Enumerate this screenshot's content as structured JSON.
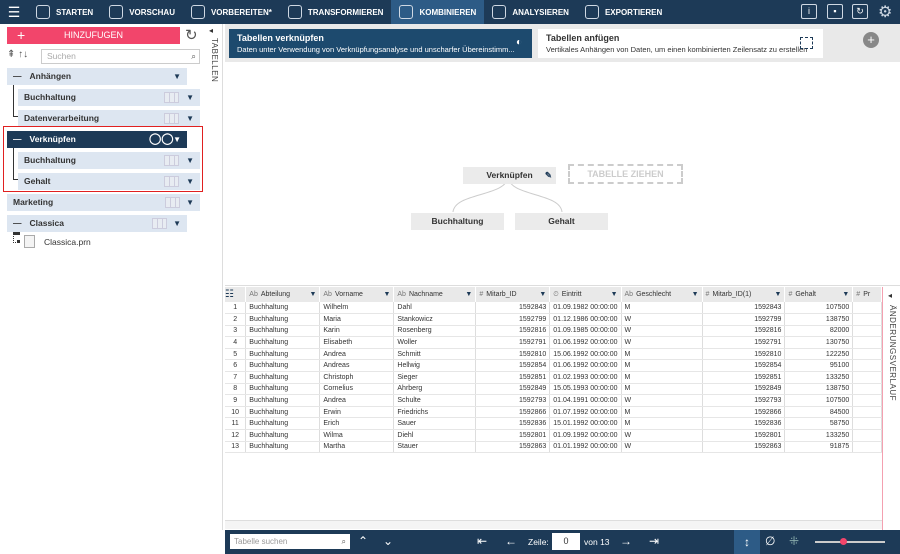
{
  "nav": [
    {
      "label": "STARTEN",
      "icon": "cube-icon"
    },
    {
      "label": "VORSCHAU",
      "icon": "eye-icon"
    },
    {
      "label": "VORBEREITEN*",
      "icon": "panel-icon"
    },
    {
      "label": "TRANSFORMIEREN",
      "icon": "cycle-icon"
    },
    {
      "label": "KOMBINIEREN",
      "icon": "combine-icon",
      "active": true
    },
    {
      "label": "ANALYSIEREN",
      "icon": "clipboard-icon"
    },
    {
      "label": "EXPORTIEREN",
      "icon": "export-icon"
    }
  ],
  "left": {
    "add_label": "HINZUFUGEN",
    "search_placeholder": "Suchen",
    "vertical_label": "TABELLEN",
    "tree": {
      "anhaengen": "Anhängen",
      "buchhaltung1": "Buchhaltung",
      "datenverarbeitung": "Datenverarbeitung",
      "verknuepfen": "Verknüpfen",
      "buchhaltung2": "Buchhaltung",
      "gehalt": "Gehalt",
      "marketing": "Marketing",
      "classica": "Classica",
      "classica_file": "Classica.prn"
    }
  },
  "cards": {
    "join_title": "Tabellen verknüpfen",
    "join_desc": "Daten unter Verwendung von Verknüpfungsanalyse und unscharfer Übereinstimm...",
    "append_title": "Tabellen anfügen",
    "append_desc": "Vertikales Anhängen von Daten, um einen kombinierten Zeilensatz zu erstellen"
  },
  "diagram": {
    "root": "Verknüpfen",
    "drop": "TABELLE ZIEHEN",
    "left": "Buchhaltung",
    "right": "Gehalt"
  },
  "grid": {
    "columns": [
      {
        "type": "Ab",
        "name": "Abteilung"
      },
      {
        "type": "Ab",
        "name": "Vorname"
      },
      {
        "type": "Ab",
        "name": "Nachname"
      },
      {
        "type": "#",
        "name": "Mitarb_ID"
      },
      {
        "type": "⏲",
        "name": "Eintritt"
      },
      {
        "type": "Ab",
        "name": "Geschlecht"
      },
      {
        "type": "#",
        "name": "Mitarb_ID(1)"
      },
      {
        "type": "#",
        "name": "Gehalt"
      },
      {
        "type": "#",
        "name": "Pr"
      }
    ],
    "rows": [
      [
        "1",
        "Buchhaltung",
        "Wilhelm",
        "Dahl",
        "1592843",
        "01.09.1982 00:00:00",
        "M",
        "1592843",
        "107500"
      ],
      [
        "2",
        "Buchhaltung",
        "Maria",
        "Stankowicz",
        "1592799",
        "01.12.1986 00:00:00",
        "W",
        "1592799",
        "138750"
      ],
      [
        "3",
        "Buchhaltung",
        "Karin",
        "Rosenberg",
        "1592816",
        "01.09.1985 00:00:00",
        "W",
        "1592816",
        "82000"
      ],
      [
        "4",
        "Buchhaltung",
        "Elisabeth",
        "Woller",
        "1592791",
        "01.06.1992 00:00:00",
        "W",
        "1592791",
        "130750"
      ],
      [
        "5",
        "Buchhaltung",
        "Andrea",
        "Schmitt",
        "1592810",
        "15.06.1992 00:00:00",
        "M",
        "1592810",
        "122250"
      ],
      [
        "6",
        "Buchhaltung",
        "Andreas",
        "Hellwig",
        "1592854",
        "01.06.1992 00:00:00",
        "M",
        "1592854",
        "95100"
      ],
      [
        "7",
        "Buchhaltung",
        "Christoph",
        "Sieger",
        "1592851",
        "01.02.1993 00:00:00",
        "M",
        "1592851",
        "133250"
      ],
      [
        "8",
        "Buchhaltung",
        "Cornelius",
        "Ahrberg",
        "1592849",
        "15.05.1993 00:00:00",
        "M",
        "1592849",
        "138750"
      ],
      [
        "9",
        "Buchhaltung",
        "Andrea",
        "Schulte",
        "1592793",
        "01.04.1991 00:00:00",
        "W",
        "1592793",
        "107500"
      ],
      [
        "10",
        "Buchhaltung",
        "Erwin",
        "Friedrichs",
        "1592866",
        "01.07.1992 00:00:00",
        "M",
        "1592866",
        "84500"
      ],
      [
        "11",
        "Buchhaltung",
        "Erich",
        "Sauer",
        "1592836",
        "15.01.1992 00:00:00",
        "M",
        "1592836",
        "58750"
      ],
      [
        "12",
        "Buchhaltung",
        "Wilma",
        "Diehl",
        "1592801",
        "01.09.1992 00:00:00",
        "W",
        "1592801",
        "133250"
      ],
      [
        "13",
        "Buchhaltung",
        "Martha",
        "Stauer",
        "1592863",
        "01.01.1992 00:00:00",
        "W",
        "1592863",
        "91875"
      ]
    ]
  },
  "right_label": "ÄNDERUNGSVERLAUF",
  "bottom": {
    "search_placeholder": "Tabelle suchen",
    "row_label": "Zeile:",
    "row_value": "0",
    "of_label": "von 13",
    "zoom_fraction": 0.4
  }
}
